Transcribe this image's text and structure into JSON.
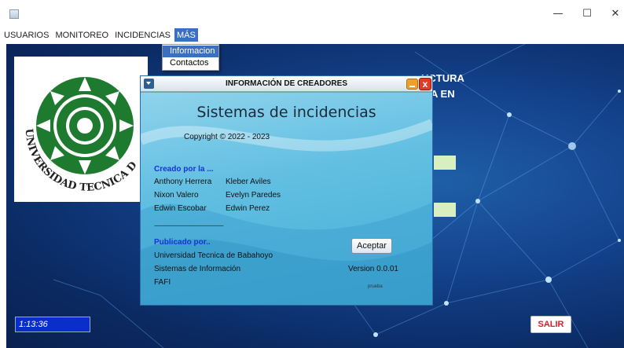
{
  "window": {
    "minimize_icon": "—",
    "maximize_icon": "☐",
    "close_icon": "✕"
  },
  "menu": {
    "items": [
      "USUARIOS",
      "MONITOREO",
      "INCIDENCIAS",
      "MÁS"
    ],
    "open_menu": "MÁS",
    "dropdown": [
      "Informacion",
      "Contactos"
    ],
    "selected_dropdown": "Informacion"
  },
  "background": {
    "heading_line1": "UCTURA",
    "heading_line2": "A EN",
    "logo_text": "UNIVERSIDAD TECNICA DE BA",
    "clock": "1:13:36",
    "exit_button": "SALIR"
  },
  "dialog": {
    "title": "INFORMACIÓN DE CREADORES",
    "heading": "Sistemas de incidencias",
    "copyright": "Copyright © 2022 - 2023",
    "created_by_label": "Creado por la ...",
    "creators_left": [
      "Anthony Herrera",
      "Nixon Valero",
      "Edwin Escobar"
    ],
    "creators_right": [
      "Kleber Aviles",
      "Evelyn Paredes",
      "Edwin Perez"
    ],
    "separator": "--------------------------------------------",
    "published_by_label": "Publicado por..",
    "publishers": [
      "Universidad Tecnica de Babahoyo",
      "Sistemas de Información",
      "FAFI"
    ],
    "accept_button": "Aceptar",
    "version": "Version  0.0.01",
    "note": "prueba"
  },
  "colors": {
    "menu_highlight": "#3b6fc1",
    "dialog_bg": "#62bfe2",
    "clock_bg": "#0a2ec9",
    "exit_text": "#d61f2c",
    "label_blue": "#1633d6"
  }
}
